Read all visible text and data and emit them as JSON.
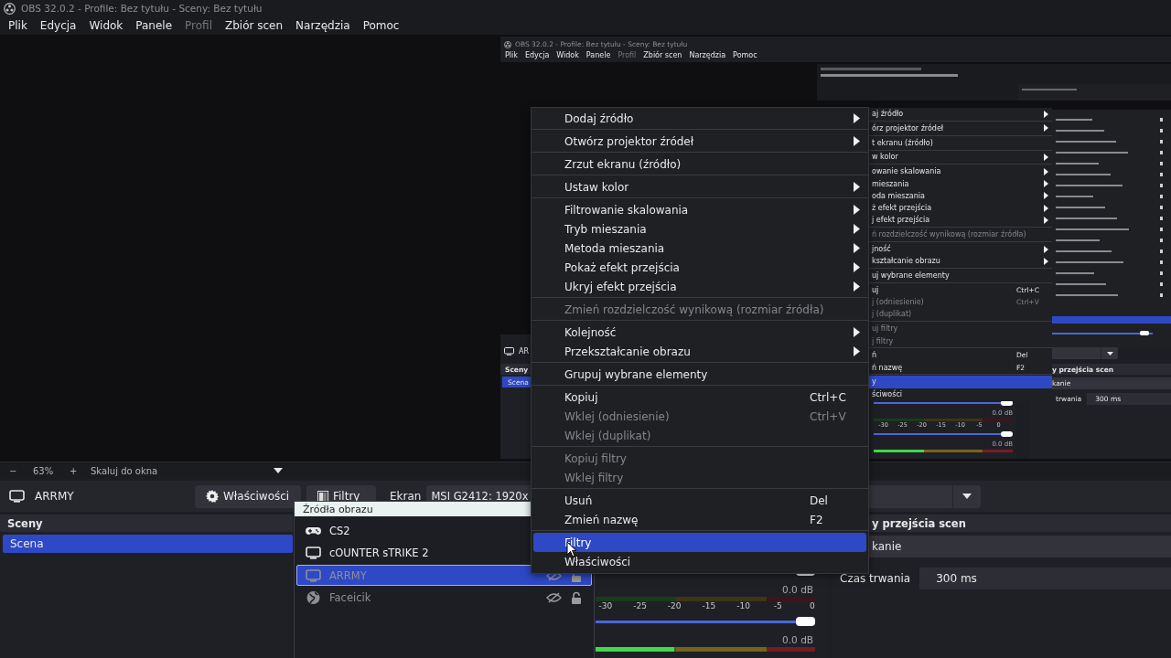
{
  "window": {
    "title": "OBS 32.0.2 - Profile: Bez tytułu - Sceny: Bez tytułu"
  },
  "menu_bar": [
    {
      "label": "Plik",
      "disabled": false
    },
    {
      "label": "Edycja",
      "disabled": false
    },
    {
      "label": "Widok",
      "disabled": false
    },
    {
      "label": "Panele",
      "disabled": false
    },
    {
      "label": "Profil",
      "disabled": true
    },
    {
      "label": "Zbiór scen",
      "disabled": false
    },
    {
      "label": "Narzędzia",
      "disabled": false
    },
    {
      "label": "Pomoc",
      "disabled": false
    }
  ],
  "preview": {
    "kind": "screen-capture",
    "capture": {
      "title": "OBS 32.0.2 - Profile: Bez tytułu - Sceny: Bez tytułu",
      "menu_bar": [
        {
          "label": "Plik",
          "disabled": false
        },
        {
          "label": "Edycja",
          "disabled": false
        },
        {
          "label": "Widok",
          "disabled": false
        },
        {
          "label": "Panele",
          "disabled": false
        },
        {
          "label": "Profil",
          "disabled": true
        },
        {
          "label": "Zbiór scen",
          "disabled": false
        },
        {
          "label": "Narzędzia",
          "disabled": false
        },
        {
          "label": "Pomoc",
          "disabled": false
        }
      ],
      "context_menu": {
        "items": [
          {
            "kind": "item",
            "label": "aj źródło",
            "submenu": true,
            "disabled": false,
            "selected": false
          },
          {
            "kind": "separator"
          },
          {
            "kind": "item",
            "label": "órz projektor źródeł",
            "submenu": true,
            "disabled": false,
            "selected": false
          },
          {
            "kind": "separator"
          },
          {
            "kind": "item",
            "label": "t ekranu (źródło)",
            "submenu": false,
            "disabled": false,
            "selected": false
          },
          {
            "kind": "separator"
          },
          {
            "kind": "item",
            "label": "w kolor",
            "submenu": true,
            "disabled": false,
            "selected": false
          },
          {
            "kind": "separator"
          },
          {
            "kind": "item",
            "label": "owanie skalowania",
            "submenu": true,
            "disabled": false,
            "selected": false
          },
          {
            "kind": "item",
            "label": "mieszania",
            "submenu": true,
            "disabled": false,
            "selected": false
          },
          {
            "kind": "item",
            "label": "oda mieszania",
            "submenu": true,
            "disabled": false,
            "selected": false
          },
          {
            "kind": "item",
            "label": "ż efekt przejścia",
            "submenu": true,
            "disabled": false,
            "selected": false
          },
          {
            "kind": "item",
            "label": "j efekt przejścia",
            "submenu": true,
            "disabled": false,
            "selected": false
          },
          {
            "kind": "separator"
          },
          {
            "kind": "item",
            "label": "ń rozdzielczość wynikową (rozmiar źródła)",
            "submenu": false,
            "disabled": true,
            "selected": false
          },
          {
            "kind": "separator"
          },
          {
            "kind": "item",
            "label": "jność",
            "submenu": true,
            "disabled": false,
            "selected": false
          },
          {
            "kind": "item",
            "label": "kształcanie obrazu",
            "submenu": true,
            "disabled": false,
            "selected": false
          },
          {
            "kind": "separator"
          },
          {
            "kind": "item",
            "label": "uj wybrane elementy",
            "submenu": false,
            "disabled": false,
            "selected": false
          },
          {
            "kind": "separator"
          },
          {
            "kind": "item",
            "label": "uj",
            "shortcut": "Ctrl+C",
            "submenu": false,
            "disabled": false,
            "selected": false
          },
          {
            "kind": "item",
            "label": "j (odniesienie)",
            "shortcut": "Ctrl+V",
            "submenu": false,
            "disabled": true,
            "selected": false
          },
          {
            "kind": "item",
            "label": "j (duplikat)",
            "submenu": false,
            "disabled": true,
            "selected": false
          },
          {
            "kind": "separator"
          },
          {
            "kind": "item",
            "label": "uj filtry",
            "submenu": false,
            "disabled": true,
            "selected": false
          },
          {
            "kind": "item",
            "label": "j filtry",
            "submenu": false,
            "disabled": true,
            "selected": false
          },
          {
            "kind": "separator"
          },
          {
            "kind": "item",
            "label": "ń",
            "shortcut": "Del",
            "submenu": false,
            "disabled": false,
            "selected": false
          },
          {
            "kind": "item",
            "label": "ń nazwę",
            "shortcut": "F2",
            "submenu": false,
            "disabled": false,
            "selected": false
          },
          {
            "kind": "separator"
          },
          {
            "kind": "item",
            "label": "y",
            "submenu": false,
            "disabled": false,
            "selected": true
          },
          {
            "kind": "item",
            "label": "ściwości",
            "submenu": false,
            "disabled": false,
            "selected": false
          }
        ]
      },
      "source_name": "AR",
      "scenes_dock": {
        "title": "Sceny",
        "scenes": [
          {
            "name": "Scena",
            "selected": true
          }
        ]
      },
      "audio_mixer": {
        "channels": [
          {
            "fader": {
              "level": 1
            }
          },
          {
            "reading": "0.0 dB",
            "meter": {
              "active": false
            },
            "scale": [
              "-30",
              "-25",
              "-20",
              "-15",
              "-10",
              "-5",
              "0"
            ],
            "fader": {
              "level": 1
            }
          },
          {
            "reading": "0.0 dB",
            "meter": {
              "active": true,
              "level": 0.36
            }
          }
        ]
      },
      "transitions_dock": {
        "title": "y przejścia scen",
        "transition": "kanie",
        "duration_label": "trwania",
        "duration": "300 ms"
      }
    }
  },
  "zoom_bar": {
    "zoom_out": "−",
    "zoom": "63%",
    "zoom_in": "+",
    "scale_mode": "Skaluj do okna"
  },
  "source_toolbar": {
    "source_name": "ARRMY",
    "properties_button": "Właściwości",
    "filters_button": "Filtry",
    "display_label": "Ekran",
    "display_value": "MSI G2412: 1920x"
  },
  "scenes_dock": {
    "title": "Sceny",
    "scenes": [
      {
        "name": "Scena",
        "selected": true
      }
    ]
  },
  "audio_mixer": {
    "channels": [
      {
        "fader": {
          "level": 1
        }
      },
      {
        "reading": "0.0 dB",
        "meter": {
          "active": false
        },
        "scale": [
          "-30",
          "-25",
          "-20",
          "-15",
          "-10",
          "-5",
          "0"
        ],
        "fader": {
          "level": 1
        }
      },
      {
        "reading": "0.0 dB",
        "meter": {
          "active": true,
          "level": 0.36
        }
      }
    ]
  },
  "transitions_dock": {
    "title": "y przejścia scen",
    "transition": "kanie",
    "duration_label": "Czas trwania",
    "duration": "300 ms"
  },
  "sources_popup": {
    "title": "Źródła obrazu",
    "items": [
      {
        "name": "CS2",
        "kind": "game",
        "selected": false
      },
      {
        "name": "cOUNTER sTRIKE 2",
        "kind": "display",
        "selected": false
      },
      {
        "name": "ARRMY",
        "kind": "display",
        "selected": true,
        "hidden": true,
        "locked": false
      },
      {
        "name": "Faceicik",
        "kind": "browser",
        "selected": false,
        "hidden": true,
        "locked": false
      }
    ]
  },
  "context_menu": {
    "items": [
      {
        "kind": "item",
        "label": "Dodaj źródło",
        "submenu": true,
        "disabled": false,
        "selected": false
      },
      {
        "kind": "separator"
      },
      {
        "kind": "item",
        "label": "Otwórz projektor źródeł",
        "submenu": true,
        "disabled": false,
        "selected": false
      },
      {
        "kind": "separator"
      },
      {
        "kind": "item",
        "label": "Zrzut ekranu (źródło)",
        "submenu": false,
        "disabled": false,
        "selected": false
      },
      {
        "kind": "separator"
      },
      {
        "kind": "item",
        "label": "Ustaw kolor",
        "submenu": true,
        "disabled": false,
        "selected": false
      },
      {
        "kind": "separator"
      },
      {
        "kind": "item",
        "label": "Filtrowanie skalowania",
        "submenu": true,
        "disabled": false,
        "selected": false
      },
      {
        "kind": "item",
        "label": "Tryb mieszania",
        "submenu": true,
        "disabled": false,
        "selected": false
      },
      {
        "kind": "item",
        "label": "Metoda mieszania",
        "submenu": true,
        "disabled": false,
        "selected": false
      },
      {
        "kind": "item",
        "label": "Pokaż efekt przejścia",
        "submenu": true,
        "disabled": false,
        "selected": false
      },
      {
        "kind": "item",
        "label": "Ukryj efekt przejścia",
        "submenu": true,
        "disabled": false,
        "selected": false
      },
      {
        "kind": "separator"
      },
      {
        "kind": "item",
        "label": "Zmień rozdzielczość wynikową (rozmiar źródła)",
        "submenu": false,
        "disabled": true,
        "selected": false
      },
      {
        "kind": "separator"
      },
      {
        "kind": "item",
        "label": "Kolejność",
        "submenu": true,
        "disabled": false,
        "selected": false
      },
      {
        "kind": "item",
        "label": "Przekształcanie obrazu",
        "submenu": true,
        "disabled": false,
        "selected": false
      },
      {
        "kind": "separator"
      },
      {
        "kind": "item",
        "label": "Grupuj wybrane elementy",
        "submenu": false,
        "disabled": false,
        "selected": false
      },
      {
        "kind": "separator"
      },
      {
        "kind": "item",
        "label": "Kopiuj",
        "shortcut": "Ctrl+C",
        "submenu": false,
        "disabled": false,
        "selected": false
      },
      {
        "kind": "item",
        "label": "Wklej (odniesienie)",
        "shortcut": "Ctrl+V",
        "submenu": false,
        "disabled": true,
        "selected": false
      },
      {
        "kind": "item",
        "label": "Wklej (duplikat)",
        "submenu": false,
        "disabled": true,
        "selected": false
      },
      {
        "kind": "separator"
      },
      {
        "kind": "item",
        "label": "Kopiuj filtry",
        "submenu": false,
        "disabled": true,
        "selected": false
      },
      {
        "kind": "item",
        "label": "Wklej filtry",
        "submenu": false,
        "disabled": true,
        "selected": false
      },
      {
        "kind": "separator"
      },
      {
        "kind": "item",
        "label": "Usuń",
        "shortcut": "Del",
        "submenu": false,
        "disabled": false,
        "selected": false
      },
      {
        "kind": "item",
        "label": "Zmień nazwę",
        "shortcut": "F2",
        "submenu": false,
        "disabled": false,
        "selected": false
      },
      {
        "kind": "separator"
      },
      {
        "kind": "item",
        "label": "Filtry",
        "submenu": false,
        "disabled": false,
        "selected": true
      },
      {
        "kind": "item",
        "label": "Właściwości",
        "submenu": false,
        "disabled": false,
        "selected": false
      }
    ]
  }
}
